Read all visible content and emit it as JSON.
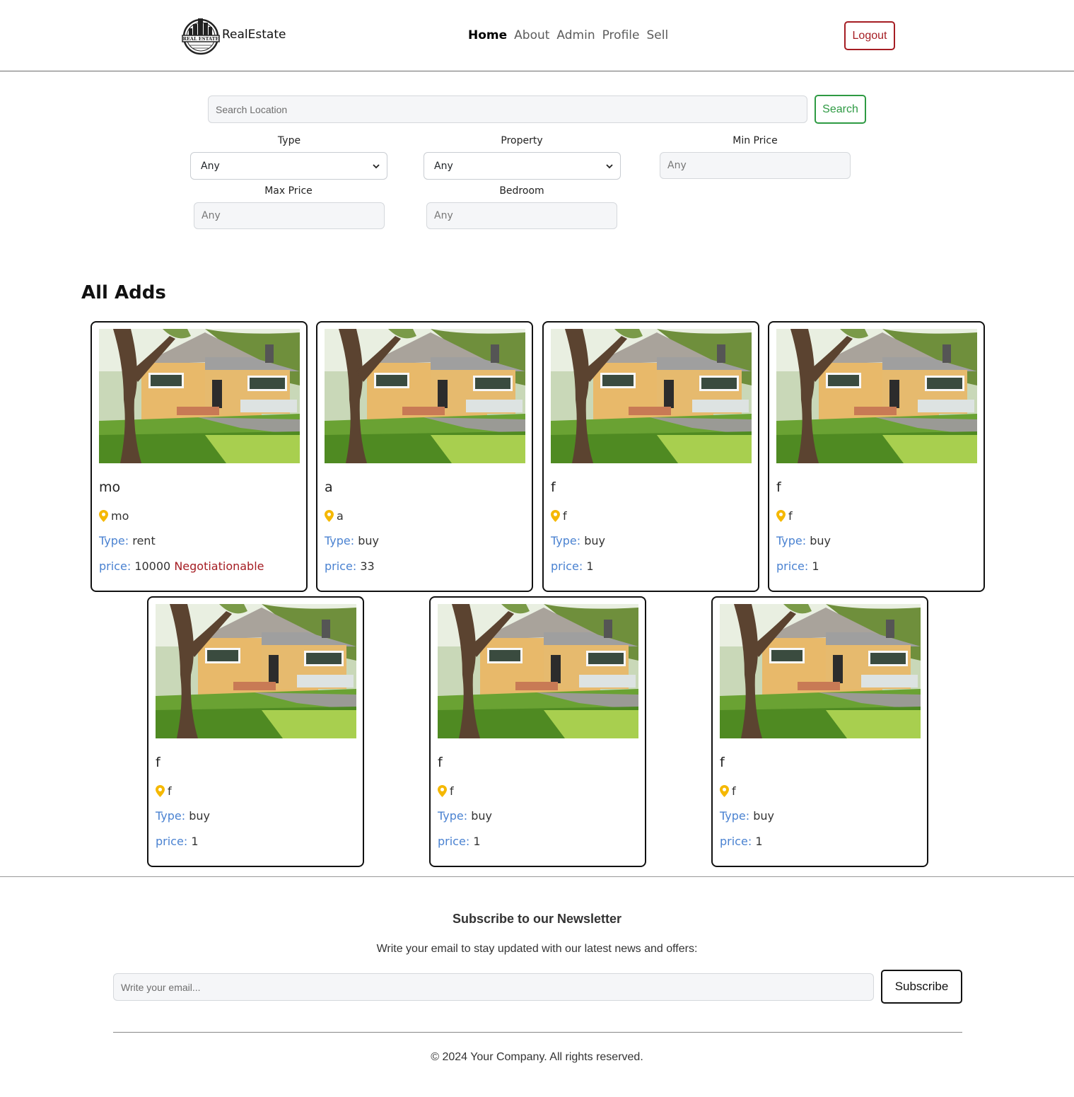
{
  "header": {
    "brand_name": "RealEstate",
    "logo_text": "REAL ESTATE",
    "nav": [
      {
        "label": "Home",
        "active": true
      },
      {
        "label": "About",
        "active": false
      },
      {
        "label": "Admin",
        "active": false
      },
      {
        "label": "Profile",
        "active": false
      },
      {
        "label": "Sell",
        "active": false
      }
    ],
    "logout_label": "Logout"
  },
  "search": {
    "placeholder": "Search Location",
    "button_label": "Search"
  },
  "filters": {
    "type_label": "Type",
    "type_value": "Any",
    "property_label": "Property",
    "property_value": "Any",
    "min_price_label": "Min Price",
    "min_price_placeholder": "Any",
    "max_price_label": "Max Price",
    "max_price_placeholder": "Any",
    "bedroom_label": "Bedroom",
    "bedroom_placeholder": "Any"
  },
  "listings_title": "All Adds",
  "labels": {
    "type": "Type:",
    "price": "price:"
  },
  "listings": [
    {
      "title": "mo",
      "location": "mo",
      "type": "rent",
      "price": "10000",
      "negotiable": "Negotiationable"
    },
    {
      "title": "a",
      "location": "a",
      "type": "buy",
      "price": "33",
      "negotiable": ""
    },
    {
      "title": "f",
      "location": "f",
      "type": "buy",
      "price": "1",
      "negotiable": ""
    },
    {
      "title": "f",
      "location": "f",
      "type": "buy",
      "price": "1",
      "negotiable": ""
    },
    {
      "title": "f",
      "location": "f",
      "type": "buy",
      "price": "1",
      "negotiable": ""
    },
    {
      "title": "f",
      "location": "f",
      "type": "buy",
      "price": "1",
      "negotiable": ""
    },
    {
      "title": "f",
      "location": "f",
      "type": "buy",
      "price": "1",
      "negotiable": ""
    }
  ],
  "newsletter": {
    "title": "Subscribe to our Newsletter",
    "subtitle": "Write your email to stay updated with our latest news and offers:",
    "email_placeholder": "Write your email...",
    "button_label": "Subscribe"
  },
  "copyright": "© 2024 Your Company. All rights reserved.",
  "colors": {
    "accent_red": "#a51d23",
    "accent_green": "#2e9a43",
    "label_blue": "#4a82d1",
    "pin_yellow": "#f5b800"
  }
}
